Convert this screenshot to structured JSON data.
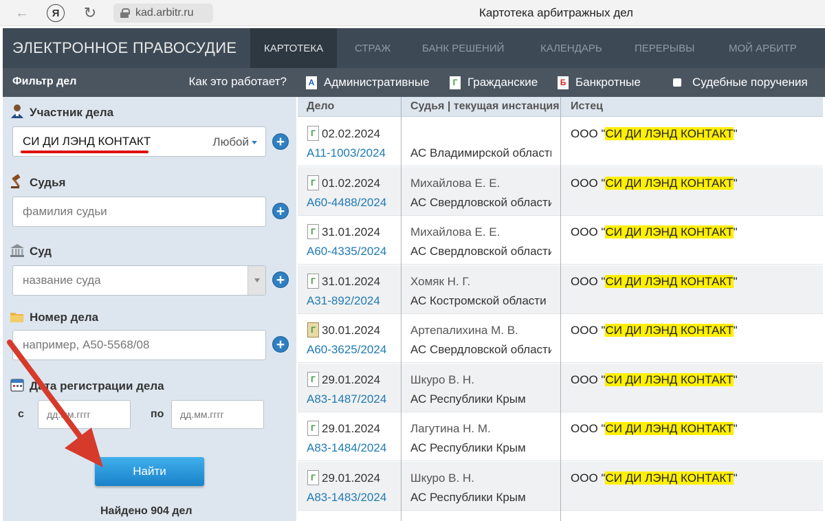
{
  "browser": {
    "url": "kad.arbitr.ru",
    "title": "Картотека арбитражных дел",
    "yandex_letter": "Я"
  },
  "nav": {
    "brand": "ЭЛЕКТРОННОЕ ПРАВОСУДИЕ",
    "items": [
      "КАРТОТЕКА",
      "СТРАЖ",
      "БАНК РЕШЕНИЙ",
      "КАЛЕНДАРЬ",
      "ПЕРЕРЫВЫ",
      "МОЙ АРБИТР"
    ],
    "active_index": 0
  },
  "filter": {
    "title": "Фильтр дел",
    "how_link": "Как это работает?",
    "participant_label": "Участник дела",
    "participant_value": "СИ ДИ ЛЭНД КОНТАКТ",
    "participant_role": "Любой",
    "judge_label": "Судья",
    "judge_placeholder": "фамилия судьи",
    "court_label": "Суд",
    "court_placeholder": "название суда",
    "case_label": "Номер дела",
    "case_placeholder": "например, А50-5568/08",
    "date_label": "Дата регистрации дела",
    "date_from_label": "с",
    "date_to_label": "по",
    "date_placeholder": "дд.мм.гггг",
    "find_button": "Найти",
    "found_text": "Найдено 904 дел"
  },
  "types": {
    "administrative": "Административные",
    "administrative_icon_letter": "А",
    "civil": "Гражданские",
    "civil_icon_letter": "Г",
    "bankrupt": "Банкротные",
    "bankrupt_icon_letter": "Б",
    "court_orders": "Судебные поручения"
  },
  "table": {
    "headers": {
      "case": "Дело",
      "judge": "Судья | текущая инстанция",
      "plaintiff": "Истец"
    },
    "rows": [
      {
        "icon": "Г",
        "date": "02.02.2024",
        "case": "А11-1003/2024",
        "judge": "",
        "court": "АС Владимирской области",
        "plaintiff_prefix": "ООО \"",
        "plaintiff_name": "СИ ДИ ЛЭНД КОНТАКТ",
        "plaintiff_suffix": "\""
      },
      {
        "icon": "Г",
        "date": "01.02.2024",
        "case": "А60-4488/2024",
        "judge": "Михайлова Е. Е.",
        "court": "АС Свердловской области",
        "plaintiff_prefix": "ООО \"",
        "plaintiff_name": "СИ ДИ ЛЭНД КОНТАКТ",
        "plaintiff_suffix": "\""
      },
      {
        "icon": "Г",
        "date": "31.01.2024",
        "case": "А60-4335/2024",
        "judge": "Михайлова Е. Е.",
        "court": "АС Свердловской области",
        "plaintiff_prefix": "ООО \"",
        "plaintiff_name": "СИ ДИ ЛЭНД КОНТАКТ",
        "plaintiff_suffix": "\""
      },
      {
        "icon": "Г",
        "date": "31.01.2024",
        "case": "А31-892/2024",
        "judge": "Хомяк Н. Г.",
        "court": "АС Костромской области",
        "plaintiff_prefix": "ООО \"",
        "plaintiff_name": "СИ ДИ ЛЭНД КОНТАКТ",
        "plaintiff_suffix": "\""
      },
      {
        "icon": "Г",
        "date": "30.01.2024",
        "case": "А60-3625/2024",
        "judge": "Артепалихина М. В.",
        "court": "АС Свердловской области",
        "plaintiff_prefix": "ООО \"",
        "plaintiff_name": "СИ ДИ ЛЭНД КОНТАКТ",
        "plaintiff_suffix": "\""
      },
      {
        "icon": "Г",
        "date": "29.01.2024",
        "case": "А83-1487/2024",
        "judge": "Шкуро В. Н.",
        "court": "АС Республики Крым",
        "plaintiff_prefix": "ООО \"",
        "plaintiff_name": "СИ ДИ ЛЭНД КОНТАКТ",
        "plaintiff_suffix": "\""
      },
      {
        "icon": "Г",
        "date": "29.01.2024",
        "case": "А83-1484/2024",
        "judge": "Лагутина Н. М.",
        "court": "АС Республики Крым",
        "plaintiff_prefix": "ООО \"",
        "plaintiff_name": "СИ ДИ ЛЭНД КОНТАКТ",
        "plaintiff_suffix": "\""
      },
      {
        "icon": "Г",
        "date": "29.01.2024",
        "case": "А83-1483/2024",
        "judge": "Шкуро В. Н.",
        "court": "АС Республики Крым",
        "plaintiff_prefix": "ООО \"",
        "plaintiff_name": "СИ ДИ ЛЭНД КОНТАКТ",
        "plaintiff_suffix": "\""
      }
    ]
  },
  "colors": {
    "nav_bg": "#3d4a55",
    "panel_bg": "#dde6ef",
    "link": "#1f7ab5",
    "highlight": "#ffef00",
    "annotation_red": "#d11"
  }
}
